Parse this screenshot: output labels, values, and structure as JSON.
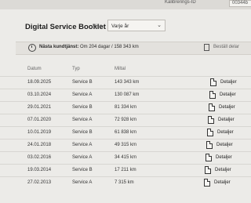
{
  "header": {
    "kalibrering_label": "Kalibrerings-ID",
    "kalibrering_value": "00344b"
  },
  "title": "Digital Service Booklet",
  "filter": {
    "label": "Visa",
    "selected": "Varje år"
  },
  "next_service": {
    "label": "Nästa kundtjänst:",
    "value": "Om 204 dagar / 158 343 km",
    "action": "Beställ delar"
  },
  "table": {
    "headers": [
      "Datum",
      "Typ",
      "Miltal"
    ],
    "details_label": "Detaljer",
    "rows": [
      {
        "date": "18.09.2025",
        "type": "Service B",
        "mileage": "143 343 km"
      },
      {
        "date": "03.10.2024",
        "type": "Service A",
        "mileage": "130 087 km"
      },
      {
        "date": "29.01.2021",
        "type": "Service B",
        "mileage": "81 334 km"
      },
      {
        "date": "07.01.2020",
        "type": "Service A",
        "mileage": "72 928 km"
      },
      {
        "date": "10.01.2019",
        "type": "Service B",
        "mileage": "61 838 km"
      },
      {
        "date": "24.01.2018",
        "type": "Service A",
        "mileage": "49 315 km"
      },
      {
        "date": "03.02.2016",
        "type": "Service A",
        "mileage": "34 415 km"
      },
      {
        "date": "19.03.2014",
        "type": "Service B",
        "mileage": "17 211 km"
      },
      {
        "date": "27.02.2013",
        "type": "Service A",
        "mileage": "7 315 km"
      }
    ]
  }
}
